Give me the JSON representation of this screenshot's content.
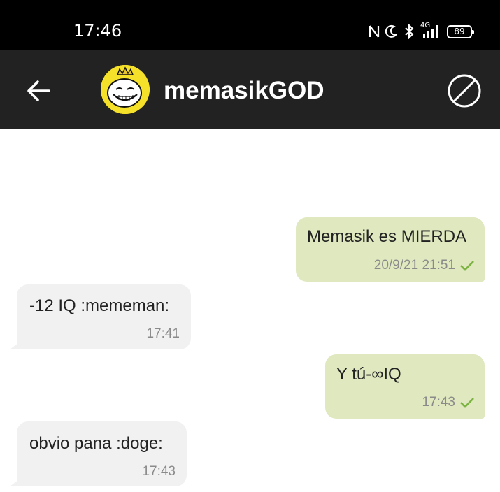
{
  "status_bar": {
    "time": "17:46",
    "network_label": "4G",
    "battery": "89",
    "icons": [
      "nfc-icon",
      "moon-icon",
      "bluetooth-icon",
      "signal-icon",
      "battery-icon"
    ]
  },
  "app_bar": {
    "contact_name": "memasikGOD",
    "back_icon": "arrow-left-icon",
    "block_icon": "block-icon",
    "colors": {
      "background": "#222222",
      "text": "#ffffff"
    }
  },
  "messages": [
    {
      "direction": "sent",
      "text": "Memasik es MIERDA",
      "time": "20/9/21 21:51",
      "status": "delivered"
    },
    {
      "direction": "received",
      "text": "-12 IQ  :mememan:",
      "time": "17:41"
    },
    {
      "direction": "sent",
      "text": "Y tú-∞IQ",
      "time": "17:43",
      "status": "delivered"
    },
    {
      "direction": "received",
      "text": "obvio pana  :doge:",
      "time": "17:43"
    }
  ],
  "colors": {
    "sent_bubble": "#dfe8bf",
    "received_bubble": "#f1f1f1",
    "check_mark": "#7cb342",
    "timestamp": "#8a8a8a"
  }
}
